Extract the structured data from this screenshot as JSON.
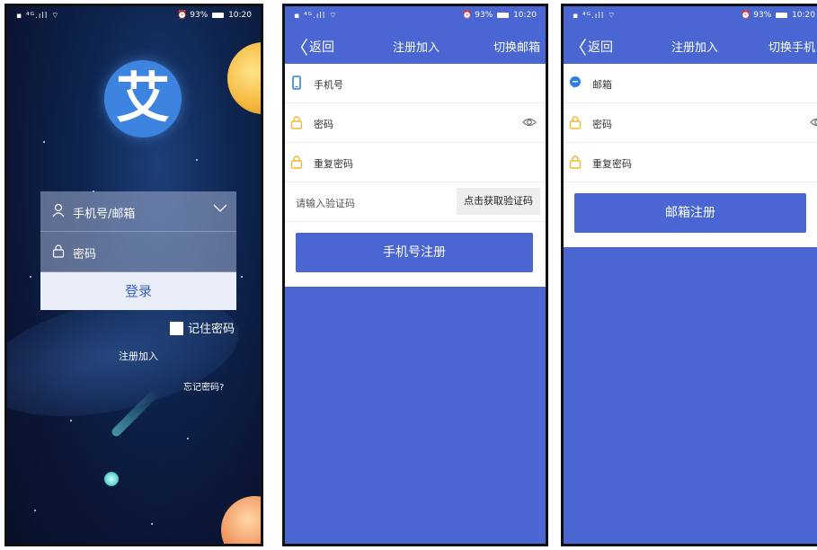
{
  "status_bar": {
    "left": "▪ ⁴ᴳ.ıll ⌔",
    "right_battery": "93%",
    "time": "10:20",
    "alarm": "⏰"
  },
  "login": {
    "logo_char": "艾",
    "account_placeholder": "手机号/邮箱",
    "password_placeholder": "密码",
    "login_button": "登录",
    "remember_label": "记住密码",
    "register_link": "注册加入",
    "forgot_link": "忘记密码?"
  },
  "register_phone": {
    "back_label": "返回",
    "title": "注册加入",
    "switch_label": "切换邮箱",
    "fields": {
      "phone": "手机号",
      "password": "密码",
      "repeat_password": "重复密码",
      "code": "请输入验证码"
    },
    "code_button": "点击获取验证码",
    "submit_label": "手机号注册"
  },
  "register_email": {
    "back_label": "返回",
    "title": "注册加入",
    "switch_label": "切换手机",
    "fields": {
      "email": "邮箱",
      "password": "密码",
      "repeat_password": "重复密码"
    },
    "submit_label": "邮箱注册"
  },
  "colors": {
    "primary": "#4966d2",
    "icon_yellow": "#f2b733",
    "icon_blue": "#2f7fe0"
  }
}
